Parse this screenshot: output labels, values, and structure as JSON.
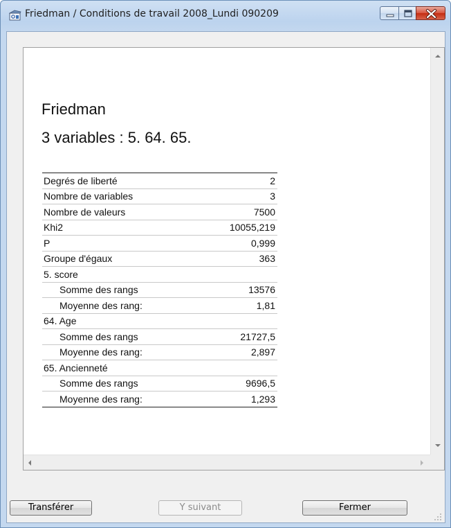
{
  "window": {
    "title": "Friedman / Conditions de travail 2008_Lundi 090209"
  },
  "report": {
    "heading": "Friedman",
    "subheading": "3 variables : 5. 64. 65.",
    "rows": [
      {
        "label": "Degrés de liberté",
        "value": "2",
        "indent": false
      },
      {
        "label": "Nombre de variables",
        "value": "3",
        "indent": false
      },
      {
        "label": "Nombre de valeurs",
        "value": "7500",
        "indent": false
      },
      {
        "label": "Khi2",
        "value": "10055,219",
        "indent": false
      },
      {
        "label": "P",
        "value": "0,999",
        "indent": false
      },
      {
        "label": "Groupe d'égaux",
        "value": "363",
        "indent": false
      },
      {
        "label": "5. score",
        "value": "",
        "indent": false
      },
      {
        "label": "Somme des rangs",
        "value": "13576",
        "indent": true
      },
      {
        "label": "Moyenne des rang:",
        "value": "1,81",
        "indent": true
      },
      {
        "label": "64. Age",
        "value": "",
        "indent": false
      },
      {
        "label": "Somme des rangs",
        "value": "21727,5",
        "indent": true
      },
      {
        "label": "Moyenne des rang:",
        "value": "2,897",
        "indent": true
      },
      {
        "label": "65. Ancienneté",
        "value": "",
        "indent": false
      },
      {
        "label": "Somme des rangs",
        "value": "9696,5",
        "indent": true
      },
      {
        "label": "Moyenne des rang:",
        "value": "1,293",
        "indent": true
      }
    ]
  },
  "buttons": {
    "transfer": "Transférer",
    "next": "Y suivant",
    "close": "Fermer"
  },
  "icons": {
    "app": "app-icon",
    "minimize": "minimize-icon",
    "maximize": "maximize-icon",
    "close": "close-icon"
  },
  "colors": {
    "title_bar": "#bcd3ee",
    "close_button": "#c42d12",
    "window_background": "#f0f0f0"
  }
}
